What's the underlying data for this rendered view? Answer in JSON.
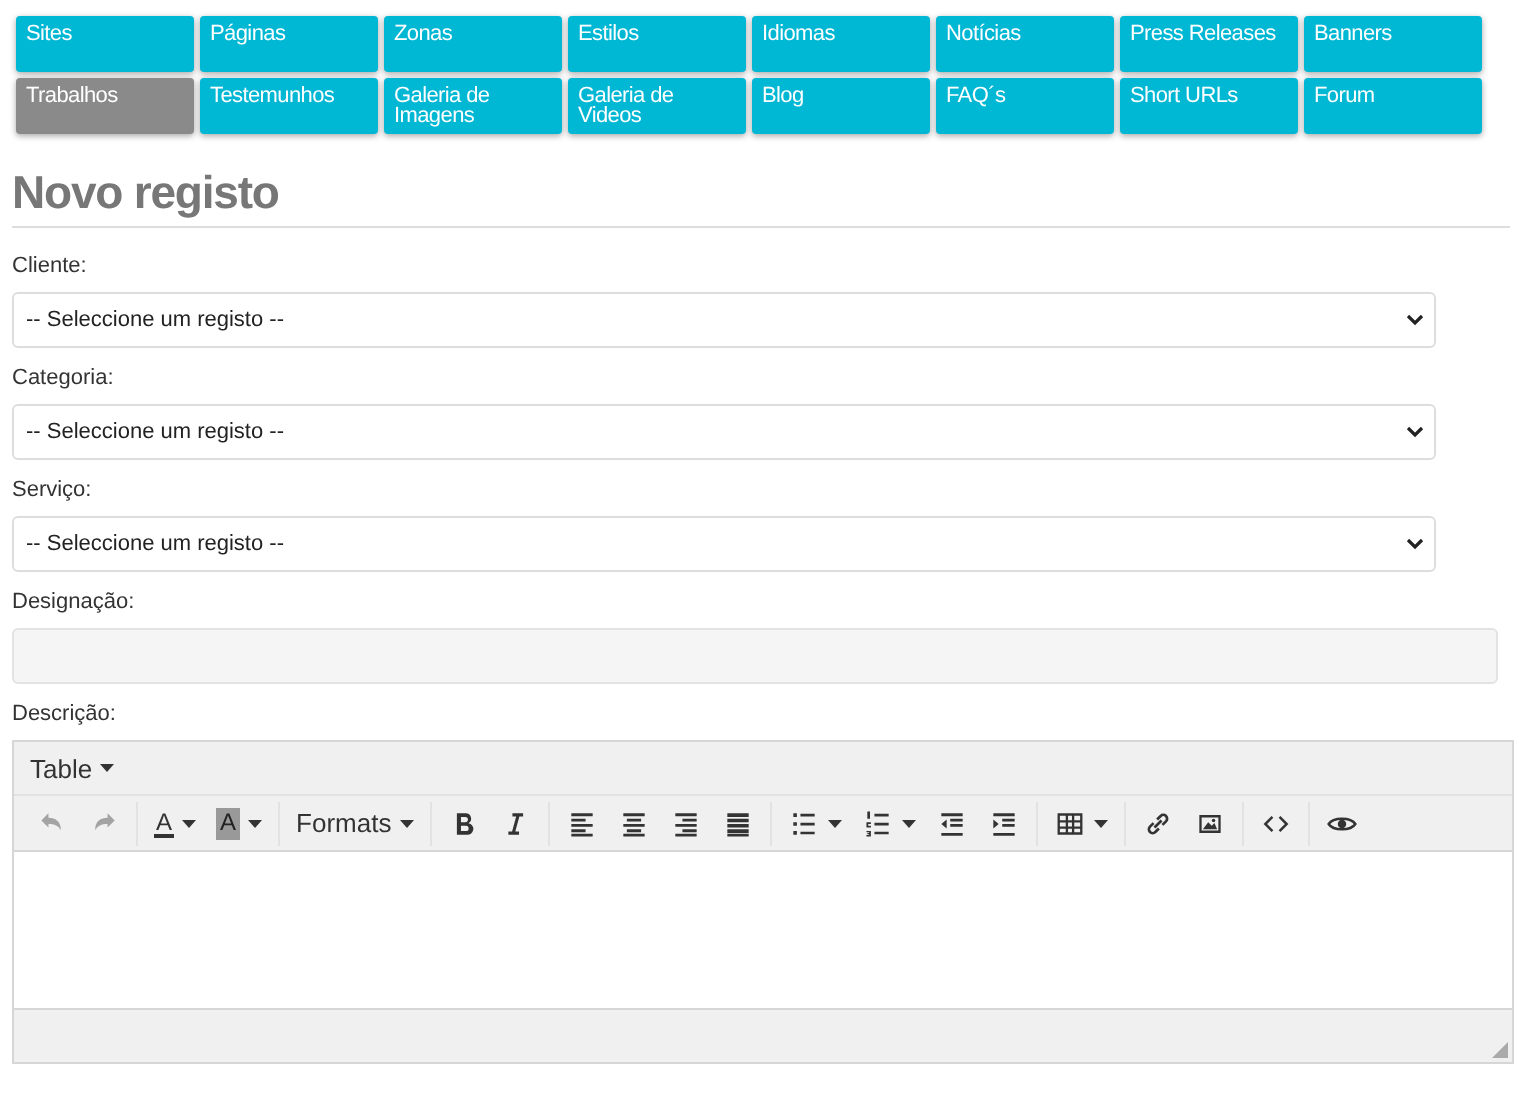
{
  "nav": {
    "items": [
      {
        "label": "Sites",
        "selected": false
      },
      {
        "label": "Páginas",
        "selected": false
      },
      {
        "label": "Zonas",
        "selected": false
      },
      {
        "label": "Estilos",
        "selected": false
      },
      {
        "label": "Idiomas",
        "selected": false
      },
      {
        "label": "Notícias",
        "selected": false
      },
      {
        "label": "Press Releases",
        "selected": false
      },
      {
        "label": "Banners",
        "selected": false
      },
      {
        "label": "Trabalhos",
        "selected": true
      },
      {
        "label": "Testemunhos",
        "selected": false
      },
      {
        "label": "Galeria de Imagens",
        "selected": false
      },
      {
        "label": "Galeria de Videos",
        "selected": false
      },
      {
        "label": "Blog",
        "selected": false
      },
      {
        "label": "FAQ´s",
        "selected": false
      },
      {
        "label": "Short URLs",
        "selected": false
      },
      {
        "label": "Forum",
        "selected": false
      }
    ]
  },
  "heading": "Novo registo",
  "form": {
    "fields": [
      {
        "kind": "select",
        "label": "Cliente:",
        "value": "-- Seleccione um registo --"
      },
      {
        "kind": "select",
        "label": "Categoria:",
        "value": "-- Seleccione um registo --"
      },
      {
        "kind": "select",
        "label": "Serviço:",
        "value": "-- Seleccione um registo --"
      },
      {
        "kind": "text",
        "label": "Designação:"
      },
      {
        "kind": "editor",
        "label": "Descrição:"
      }
    ]
  },
  "editor": {
    "menubar": [
      {
        "label": "Table"
      }
    ],
    "toolbar": [
      [
        {
          "kind": "undo",
          "disabled": true
        },
        {
          "kind": "redo",
          "disabled": true
        }
      ],
      [
        {
          "kind": "text-color",
          "label": "A",
          "disabled": false
        },
        {
          "kind": "highlight",
          "label": "A",
          "disabled": false
        }
      ],
      [
        {
          "kind": "formats",
          "label": "Formats",
          "disabled": false
        }
      ],
      [
        {
          "kind": "bold",
          "disabled": false
        },
        {
          "kind": "italic",
          "disabled": false
        }
      ],
      [
        {
          "kind": "align-left",
          "disabled": false
        },
        {
          "kind": "align-center",
          "disabled": false
        },
        {
          "kind": "align-right",
          "disabled": false
        },
        {
          "kind": "justify",
          "disabled": false
        }
      ],
      [
        {
          "kind": "bullet-list",
          "disabled": false
        },
        {
          "kind": "numbered-list",
          "disabled": false
        },
        {
          "kind": "outdent",
          "disabled": false
        },
        {
          "kind": "indent",
          "disabled": false
        }
      ],
      [
        {
          "kind": "table",
          "disabled": false
        }
      ],
      [
        {
          "kind": "link",
          "disabled": false
        },
        {
          "kind": "image",
          "disabled": false
        }
      ],
      [
        {
          "kind": "code",
          "disabled": false
        }
      ],
      [
        {
          "kind": "preview",
          "disabled": false
        }
      ]
    ]
  }
}
